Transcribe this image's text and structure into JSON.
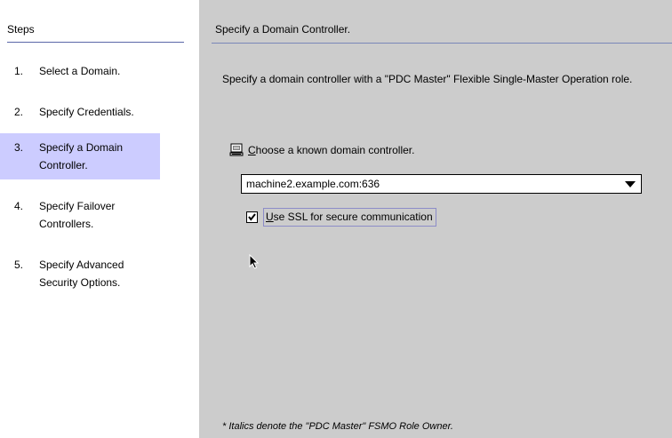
{
  "steps_panel": {
    "header": "Steps",
    "items": [
      {
        "num": "1.",
        "label": "Select a Domain.",
        "active": false
      },
      {
        "num": "2.",
        "label": "Specify Credentials.",
        "active": false
      },
      {
        "num": "3.",
        "label": "Specify a Domain Controller.",
        "active": true
      },
      {
        "num": "4.",
        "label": "Specify Failover Controllers.",
        "active": false
      },
      {
        "num": "5.",
        "label": "Specify Advanced Security Options.",
        "active": false
      }
    ]
  },
  "content": {
    "title": "Specify a Domain Controller.",
    "description": "Specify a domain controller with a \"PDC Master\" Flexible Single-Master Operation role.",
    "choose_label_mnemonic": "C",
    "choose_label_rest": "hoose a known domain controller.",
    "controller_select_value": "machine2.example.com:636",
    "ssl_checked": true,
    "ssl_label_mnemonic": "U",
    "ssl_label_rest": "se SSL for secure communication",
    "footnote": "* Italics denote the \"PDC Master\" FSMO Role Owner."
  },
  "colors": {
    "content_background": "#cccccc",
    "active_step": "#ccccff",
    "divider": "#5b67a8"
  },
  "icons": {
    "computer": "computer-icon",
    "check": "check-icon",
    "dropdown": "chevron-down-icon",
    "cursor": "mouse-pointer-icon"
  }
}
